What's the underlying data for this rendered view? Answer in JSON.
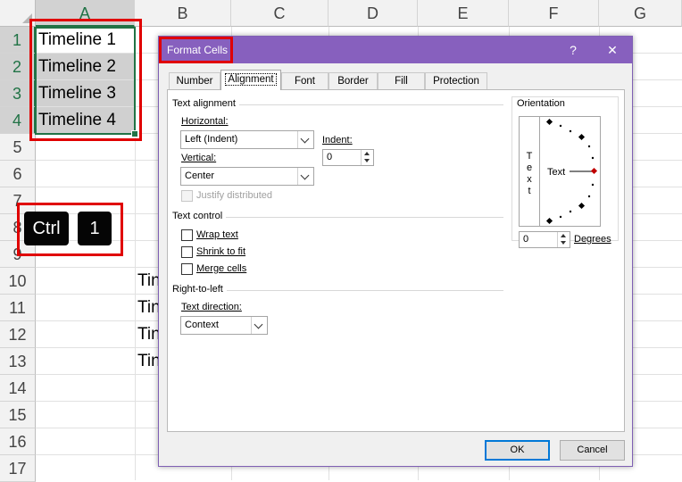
{
  "sheet": {
    "columns": [
      "A",
      "B",
      "C",
      "D",
      "E",
      "F",
      "G"
    ],
    "rows": [
      "1",
      "2",
      "3",
      "4",
      "5",
      "6",
      "7",
      "8",
      "9",
      "10",
      "11",
      "12",
      "13",
      "14",
      "15",
      "16",
      "17"
    ],
    "colA": [
      "Timeline 1",
      "Timeline 2",
      "Timeline 3",
      "Timeline 4"
    ],
    "colB": [
      "Tin",
      "Tin",
      "Tin",
      "Tin"
    ]
  },
  "keys": {
    "ctrl": "Ctrl",
    "one": "1"
  },
  "dialog": {
    "title": "Format Cells",
    "help": "?",
    "close": "✕",
    "tabs": [
      "Number",
      "Alignment",
      "Font",
      "Border",
      "Fill",
      "Protection"
    ],
    "text_alignment": {
      "group": "Text alignment",
      "horizontal_label": "Horizontal:",
      "horizontal_value": "Left (Indent)",
      "vertical_label": "Vertical:",
      "vertical_value": "Center",
      "indent_label": "Indent:",
      "indent_value": "0",
      "justify_distributed": "Justify distributed"
    },
    "text_control": {
      "group": "Text control",
      "wrap": "Wrap text",
      "shrink": "Shrink to fit",
      "merge": "Merge cells"
    },
    "rtl": {
      "group": "Right-to-left",
      "direction_label": "Text direction:",
      "direction_value": "Context"
    },
    "orientation": {
      "group": "Orientation",
      "vertical_text": [
        "T",
        "e",
        "x",
        "t"
      ],
      "dial_text": "Text",
      "degrees_value": "0",
      "degrees_label": "Degrees"
    },
    "ok": "OK",
    "cancel": "Cancel",
    "colors": {
      "titlebar": "#8760be",
      "selection": "#217346",
      "highlight": "#e00000"
    }
  }
}
